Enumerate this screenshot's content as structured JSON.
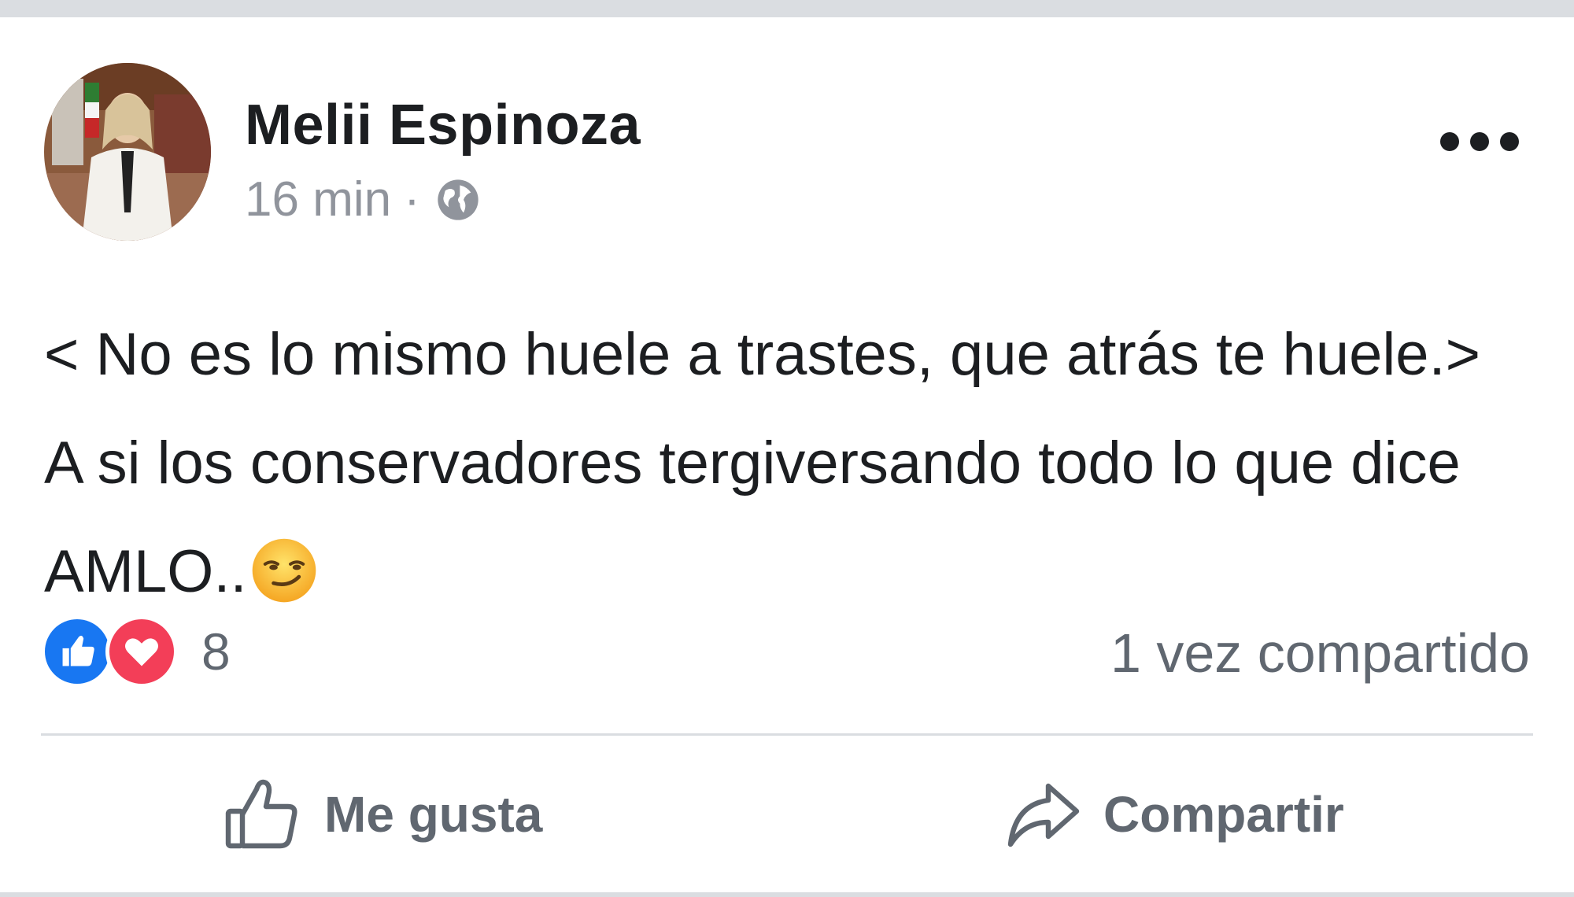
{
  "post": {
    "author": "Melii Espinoza",
    "time": "16 min",
    "separator": "·",
    "audience_icon": "globe-icon",
    "menu_icon": "more-options-icon",
    "text_line1": "< No es lo mismo huele a trastes, que atrás te huele.>",
    "text_line2a": "A si los conservadores tergiversando todo lo que dice",
    "text_line2b": "AMLO..",
    "emoji": "smirking-face-icon"
  },
  "reactions": {
    "icons": [
      "like-reaction-icon",
      "love-reaction-icon"
    ],
    "count": "8",
    "shares": "1 vez compartido"
  },
  "actions": {
    "like_label": "Me gusta",
    "share_label": "Compartir"
  },
  "colors": {
    "like_blue": "#1877f2",
    "love_red": "#f33e58",
    "text": "#1c1e21",
    "secondary_text": "#606770",
    "divider": "#dadde1"
  }
}
